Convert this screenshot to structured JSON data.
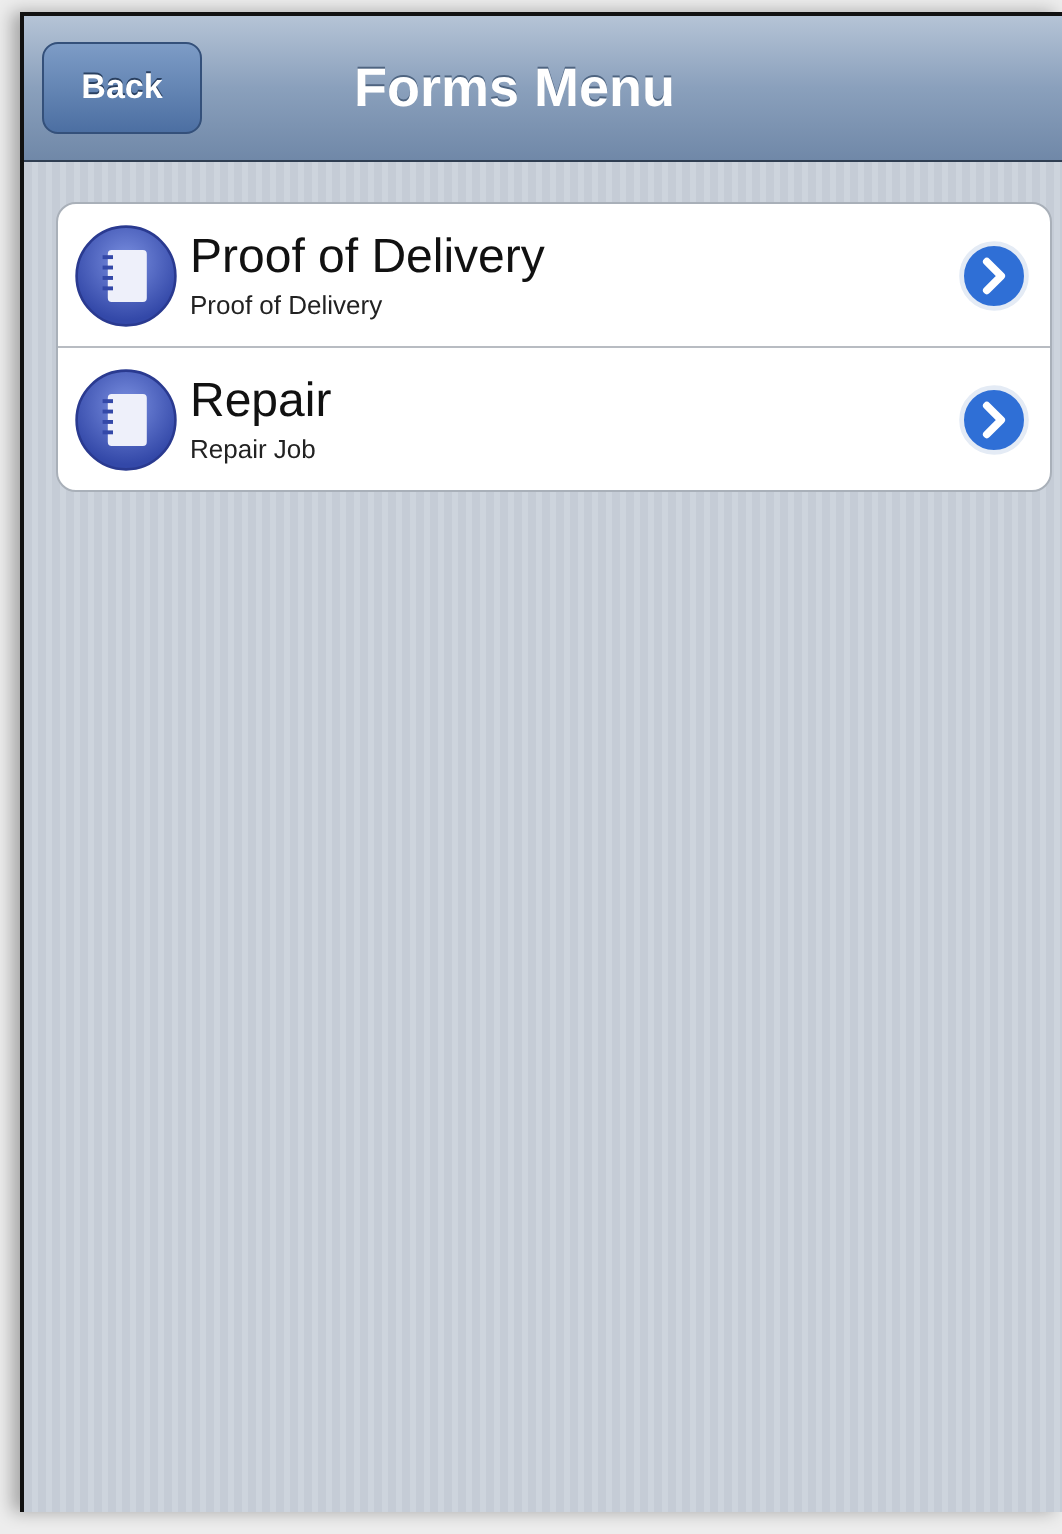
{
  "nav_bar": {
    "title": "Forms Menu",
    "back_button": "Back"
  },
  "forms": [
    {
      "title": "Proof of Delivery",
      "subtitle": "Proof of Delivery"
    },
    {
      "title": "Repair",
      "subtitle": "Repair Job"
    }
  ]
}
